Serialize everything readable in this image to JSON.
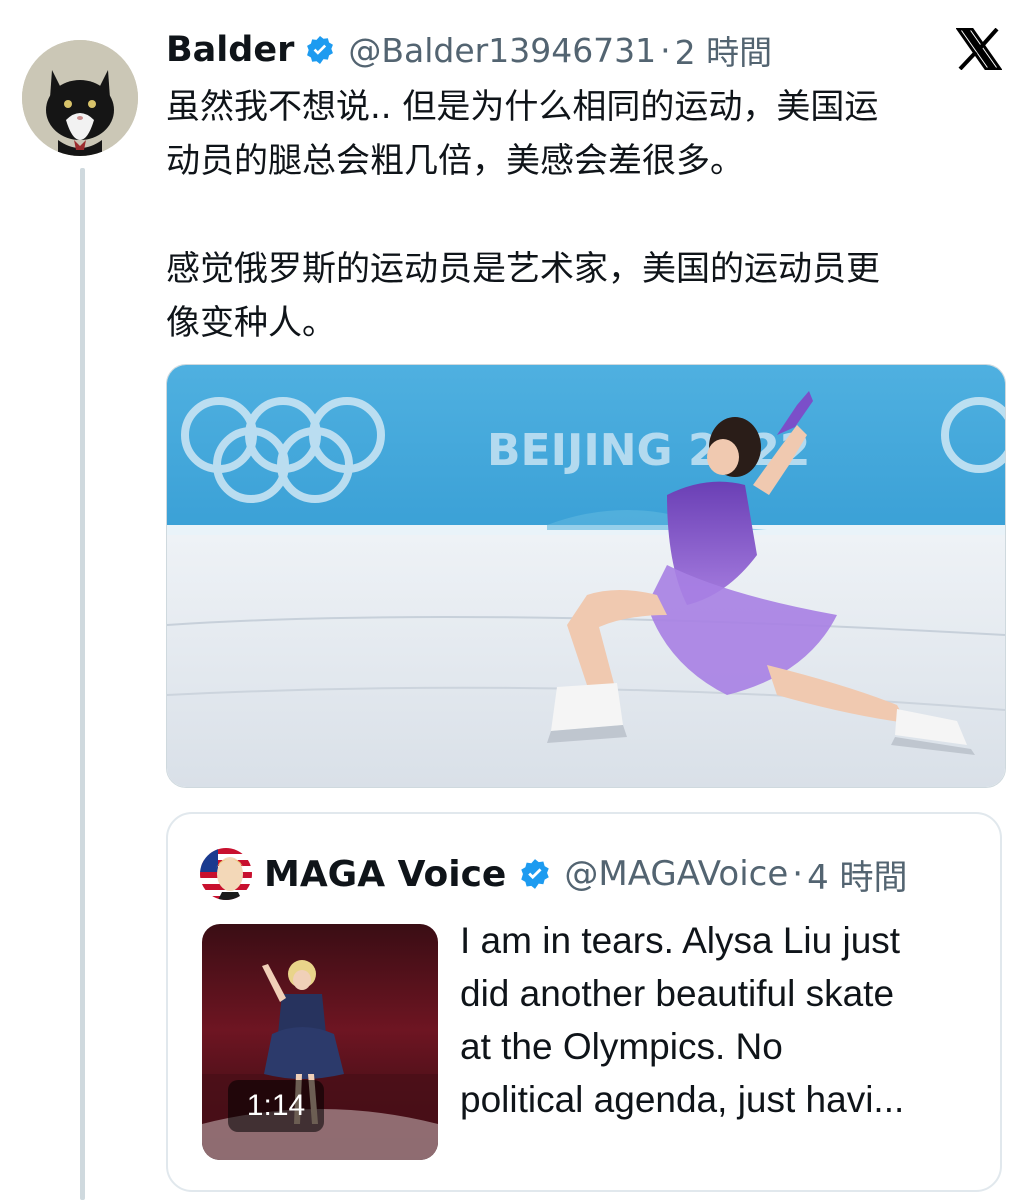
{
  "tweet": {
    "author_name": "Balder",
    "author_handle": "@Balder13946731",
    "dot": "·",
    "time": "2 時間",
    "lines": [
      "虽然我不想说.. 但是为什么相同的运动，美国运",
      "动员的腿总会粗几倍，美感会差很多。",
      "感觉俄罗斯的运动员是艺术家，美国的运动员更",
      "像变种人。"
    ],
    "media_watermark": "BEIJING 2022"
  },
  "platform": {
    "logo_icon": "x-logo-icon"
  },
  "quote": {
    "author_name": "MAGA Voice",
    "author_handle": "@MAGAVoice",
    "dot": "·",
    "time": "4 時間",
    "video_duration": "1:14",
    "text_lines": [
      "I am in tears. Alysa Liu just",
      "did another beautiful skate",
      "at the Olympics. No",
      "political agenda, just havi..."
    ]
  },
  "colors": {
    "verified_blue": "#1d9bf0",
    "secondary_text": "#536471",
    "thread_line": "#cfd9de"
  }
}
